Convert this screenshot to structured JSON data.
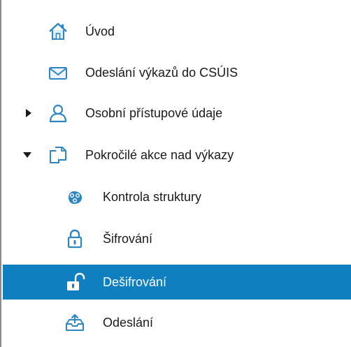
{
  "tree": {
    "items": [
      {
        "label": "Úvod",
        "icon": "home-icon",
        "expander": "none",
        "selected": false
      },
      {
        "label": "Odeslání výkazů do CSÚIS",
        "icon": "envelope-icon",
        "expander": "none",
        "selected": false
      },
      {
        "label": "Osobní přístupové údaje",
        "icon": "user-icon",
        "expander": "collapsed",
        "selected": false
      },
      {
        "label": "Pokročilé akce nad výkazy",
        "icon": "documents-icon",
        "expander": "expanded",
        "selected": false
      },
      {
        "label": "Kontrola struktury",
        "icon": "structure-check-icon",
        "expander": "none",
        "selected": false
      },
      {
        "label": "Šifrování",
        "icon": "lock-icon",
        "expander": "none",
        "selected": false
      },
      {
        "label": "Dešifrování",
        "icon": "unlock-icon",
        "expander": "none",
        "selected": true
      },
      {
        "label": "Odeslání",
        "icon": "outbox-icon",
        "expander": "none",
        "selected": false
      }
    ]
  },
  "colors": {
    "selection": "#0f7fbf",
    "icon_blue": "#2e86c1",
    "text": "#1a1a1a"
  }
}
